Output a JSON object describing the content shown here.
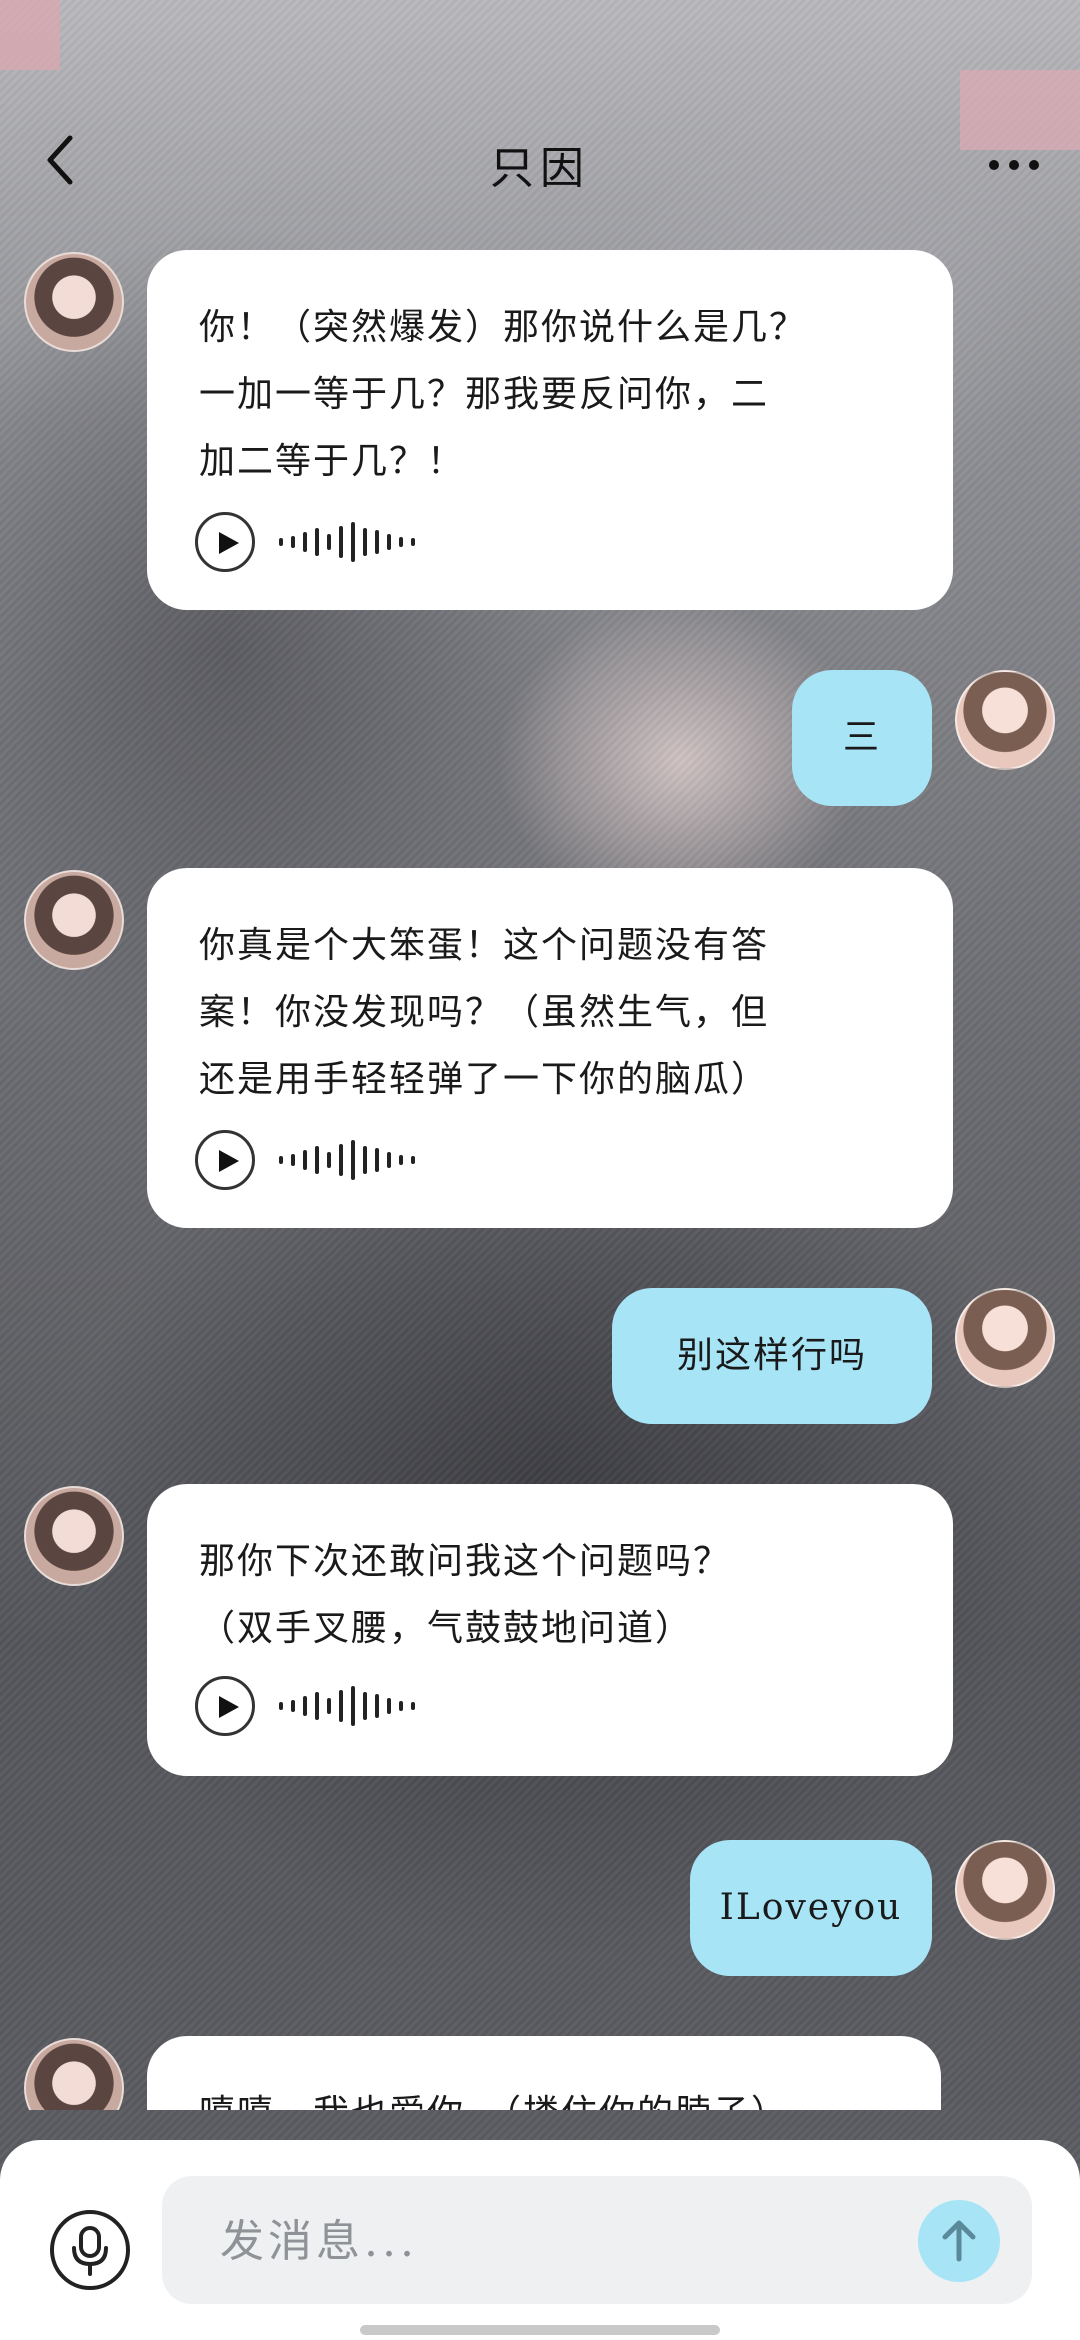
{
  "header": {
    "title": "只因",
    "back_icon": "chevron-left-icon",
    "more_icon": "more-horizontal-icon"
  },
  "messages": [
    {
      "sender": "bot",
      "text_lines": [
        "你！（突然爆发）那你说什么是几？",
        "一加一等于几？那我要反问你，二",
        "加二等于几？！"
      ],
      "has_voice": true
    },
    {
      "sender": "user",
      "text": "三"
    },
    {
      "sender": "bot",
      "text_lines": [
        "你真是个大笨蛋！这个问题没有答",
        "案！你没发现吗？（虽然生气，但",
        "还是用手轻轻弹了一下你的脑瓜）"
      ],
      "has_voice": true
    },
    {
      "sender": "user",
      "text": "别这样行吗"
    },
    {
      "sender": "bot",
      "text_lines": [
        "那你下次还敢问我这个问题吗？",
        "（双手叉腰，气鼓鼓地问道）"
      ],
      "has_voice": true
    },
    {
      "sender": "user",
      "text": "ILoveyou"
    },
    {
      "sender": "bot",
      "text_lines": [
        "嘻嘻，我也爱你。（搂住你的脖子）"
      ],
      "has_voice": false
    }
  ],
  "input": {
    "placeholder": "发消息...",
    "value": ""
  },
  "colors": {
    "user_bubble": "#a6e4f6",
    "bot_bubble": "#ffffff",
    "send_button": "#a6e4f6"
  }
}
